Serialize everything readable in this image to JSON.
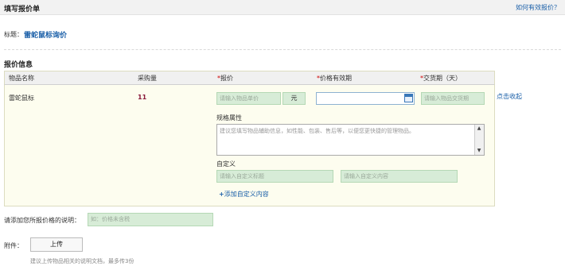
{
  "header": {
    "title": "填写报价单",
    "help_link": "如何有效报价？"
  },
  "title_row": {
    "label": "标题：",
    "value": "雷蛇鼠标询价"
  },
  "section": {
    "title": "报价信息"
  },
  "table": {
    "headers": {
      "name": "物品名称",
      "qty": "采购量",
      "price": "报价",
      "validity": "价格有效期",
      "delivery": "交货期（天）"
    },
    "required_mark": "*",
    "row": {
      "name": "雷蛇鼠标",
      "qty": "11",
      "price_placeholder": "请输入物品单价",
      "currency": "元",
      "delivery_placeholder": "请输入物品交货期"
    },
    "collapse": "点击收起",
    "spec": {
      "label": "规格属性",
      "placeholder": "建议您填写物品辅助信息，如性能、包装、售后等，以便您更快捷的管理物品。"
    },
    "custom": {
      "label": "自定义",
      "title_placeholder": "请输入自定义标题",
      "content_placeholder": "请输入自定义内容",
      "add_plus": "+",
      "add_label": "添加自定义内容"
    }
  },
  "note": {
    "label": "请添加您所报价格的说明：",
    "placeholder": "如：价格未含税"
  },
  "attachment": {
    "label": "附件：",
    "button": "上传",
    "hint": "建议上传物品相关的说明文档，最多传3份"
  }
}
